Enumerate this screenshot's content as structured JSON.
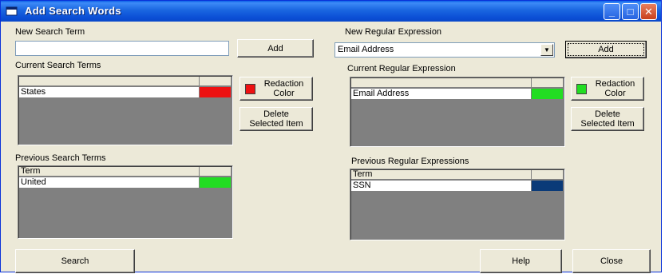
{
  "window": {
    "title": "Add Search Words"
  },
  "left": {
    "new_term_label": "New Search Term",
    "new_term_value": "",
    "add_label": "Add",
    "current_label": "Current Search Terms",
    "current_header": "",
    "current_rows": [
      {
        "term": "States",
        "color": "#ee1111"
      }
    ],
    "redaction_color_line1": "Redaction",
    "redaction_color_line2": "Color",
    "redaction_swatch": "#ee1111",
    "delete_line1": "Delete",
    "delete_line2": "Selected Item",
    "previous_label": "Previous Search Terms",
    "previous_header": "Term",
    "previous_rows": [
      {
        "term": "United",
        "color": "#22dd22"
      }
    ]
  },
  "right": {
    "new_regex_label": "New Regular Expression",
    "regex_selected": "Email Address",
    "add_label": "Add",
    "current_label": "Current Regular Expression",
    "current_header": "",
    "current_rows": [
      {
        "term": "Email Address",
        "color": "#22dd22"
      }
    ],
    "redaction_color_line1": "Redaction",
    "redaction_color_line2": "Color",
    "redaction_swatch": "#22dd22",
    "delete_line1": "Delete",
    "delete_line2": "Selected Item",
    "previous_label": "Previous Regular Expressions",
    "previous_header": "Term",
    "previous_rows": [
      {
        "term": "SSN",
        "color": "#0a3a78"
      }
    ]
  },
  "footer": {
    "search_label": "Search",
    "help_label": "Help",
    "close_label": "Close"
  },
  "icons": {
    "app": "window-icon",
    "minimize": "minimize-icon",
    "maximize": "maximize-icon",
    "close": "close-icon",
    "dropdown": "chevron-down-icon"
  }
}
